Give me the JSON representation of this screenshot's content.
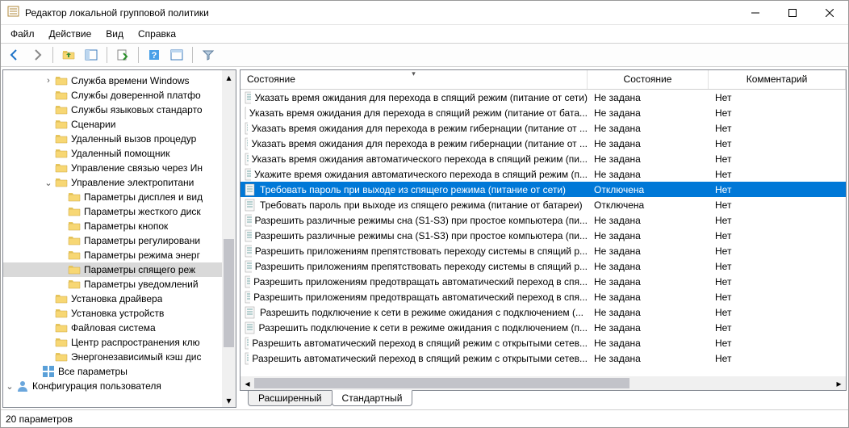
{
  "window": {
    "title": "Редактор локальной групповой политики"
  },
  "menu": {
    "file": "Файл",
    "action": "Действие",
    "view": "Вид",
    "help": "Справка"
  },
  "tree": {
    "items": [
      {
        "indent": 3,
        "exp": ">",
        "icon": "folder",
        "label": "Служба времени Windows"
      },
      {
        "indent": 3,
        "exp": "",
        "icon": "folder",
        "label": "Службы доверенной платфо"
      },
      {
        "indent": 3,
        "exp": "",
        "icon": "folder",
        "label": "Службы языковых стандарто"
      },
      {
        "indent": 3,
        "exp": "",
        "icon": "folder",
        "label": "Сценарии"
      },
      {
        "indent": 3,
        "exp": "",
        "icon": "folder",
        "label": "Удаленный вызов процедур"
      },
      {
        "indent": 3,
        "exp": "",
        "icon": "folder",
        "label": "Удаленный помощник"
      },
      {
        "indent": 3,
        "exp": "",
        "icon": "folder",
        "label": "Управление связью через Ин"
      },
      {
        "indent": 3,
        "exp": "v",
        "icon": "folder",
        "label": "Управление электропитани"
      },
      {
        "indent": 4,
        "exp": "",
        "icon": "folder",
        "label": "Параметры дисплея и вид"
      },
      {
        "indent": 4,
        "exp": "",
        "icon": "folder",
        "label": "Параметры жесткого диск"
      },
      {
        "indent": 4,
        "exp": "",
        "icon": "folder",
        "label": "Параметры кнопок"
      },
      {
        "indent": 4,
        "exp": "",
        "icon": "folder",
        "label": "Параметры регулировани"
      },
      {
        "indent": 4,
        "exp": "",
        "icon": "folder",
        "label": "Параметры режима энерг"
      },
      {
        "indent": 4,
        "exp": "",
        "icon": "folder",
        "label": "Параметры спящего реж",
        "selected": true
      },
      {
        "indent": 4,
        "exp": "",
        "icon": "folder",
        "label": "Параметры уведомлений"
      },
      {
        "indent": 3,
        "exp": "",
        "icon": "folder",
        "label": "Установка драйвера"
      },
      {
        "indent": 3,
        "exp": "",
        "icon": "folder",
        "label": "Установка устройств"
      },
      {
        "indent": 3,
        "exp": "",
        "icon": "folder",
        "label": "Файловая система"
      },
      {
        "indent": 3,
        "exp": "",
        "icon": "folder",
        "label": "Центр распространения клю"
      },
      {
        "indent": 3,
        "exp": "",
        "icon": "folder",
        "label": "Энергонезависимый кэш дис"
      },
      {
        "indent": 2,
        "exp": "",
        "icon": "all",
        "label": "Все параметры"
      },
      {
        "indent": 0,
        "exp": "v",
        "icon": "user",
        "label": "Конфигурация пользователя"
      }
    ]
  },
  "columns": {
    "c1": "Состояние",
    "c2": "Состояние",
    "c3": "Комментарий"
  },
  "rows": [
    {
      "name": "Указать время ожидания для перехода в спящий режим (питание от сети)",
      "state": "Не задана",
      "comment": "Нет"
    },
    {
      "name": "Указать время ожидания для перехода в спящий режим (питание от бата...",
      "state": "Не задана",
      "comment": "Нет"
    },
    {
      "name": "Указать время ожидания для перехода в режим гибернации (питание от ...",
      "state": "Не задана",
      "comment": "Нет"
    },
    {
      "name": "Указать время ожидания для перехода в режим гибернации (питание от ...",
      "state": "Не задана",
      "comment": "Нет"
    },
    {
      "name": "Указать время ожидания автоматического перехода в спящий режим (пи...",
      "state": "Не задана",
      "comment": "Нет"
    },
    {
      "name": "Укажите время ожидания автоматического перехода в спящий режим (п...",
      "state": "Не задана",
      "comment": "Нет"
    },
    {
      "name": "Требовать пароль при выходе из спящего режима (питание от сети)",
      "state": "Отключена",
      "comment": "Нет",
      "selected": true
    },
    {
      "name": "Требовать пароль при выходе из спящего режима (питание от батареи)",
      "state": "Отключена",
      "comment": "Нет"
    },
    {
      "name": "Разрешить различные режимы сна (S1-S3) при простое компьютера (пи...",
      "state": "Не задана",
      "comment": "Нет"
    },
    {
      "name": "Разрешить различные режимы сна (S1-S3) при простое компьютера (пи...",
      "state": "Не задана",
      "comment": "Нет"
    },
    {
      "name": "Разрешить приложениям препятствовать переходу системы в спящий р...",
      "state": "Не задана",
      "comment": "Нет"
    },
    {
      "name": "Разрешить приложениям препятствовать переходу системы в спящий р...",
      "state": "Не задана",
      "comment": "Нет"
    },
    {
      "name": "Разрешить приложениям предотвращать автоматический переход в спя...",
      "state": "Не задана",
      "comment": "Нет"
    },
    {
      "name": "Разрешить приложениям предотвращать автоматический переход в спя...",
      "state": "Не задана",
      "comment": "Нет"
    },
    {
      "name": "Разрешить подключение к сети в режиме ожидания с подключением (...",
      "state": "Не задана",
      "comment": "Нет"
    },
    {
      "name": "Разрешить подключение к сети в режиме ожидания с подключением (п...",
      "state": "Не задана",
      "comment": "Нет"
    },
    {
      "name": "Разрешить автоматический переход в спящий режим с открытыми сетев...",
      "state": "Не задана",
      "comment": "Нет"
    },
    {
      "name": "Разрешить автоматический переход в спящий режим с открытыми сетев...",
      "state": "Не задана",
      "comment": "Нет"
    }
  ],
  "tabs": {
    "extended": "Расширенный",
    "standard": "Стандартный"
  },
  "status": {
    "text": "20 параметров"
  }
}
